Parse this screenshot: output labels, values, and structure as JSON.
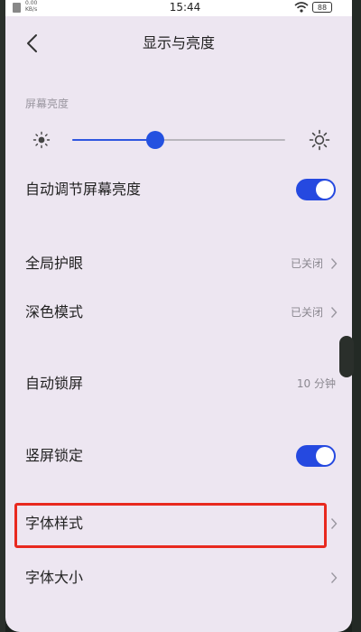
{
  "status_bar": {
    "net_speed": "0.00",
    "net_unit": "KB/s",
    "time": "15:44",
    "battery": "88"
  },
  "header": {
    "title": "显示与亮度"
  },
  "brightness": {
    "section_label": "屏幕亮度",
    "level": 0.39
  },
  "settings": {
    "auto_brightness": {
      "label": "自动调节屏幕亮度",
      "enabled": true
    },
    "eye_protection": {
      "label": "全局护眼",
      "value": "已关闭"
    },
    "dark_mode": {
      "label": "深色模式",
      "value": "已关闭"
    },
    "auto_lock": {
      "label": "自动锁屏",
      "value": "10 分钟"
    },
    "portrait_lock": {
      "label": "竖屏锁定",
      "enabled": true
    },
    "font_style": {
      "label": "字体样式"
    },
    "font_size": {
      "label": "字体大小"
    }
  },
  "colors": {
    "accent": "#2451e0",
    "highlight": "#e8291f",
    "background": "#ede6f1"
  },
  "icons": [
    "back-icon",
    "sun-small-icon",
    "sun-large-icon",
    "chevron-right-icon",
    "wifi-icon",
    "battery-icon"
  ]
}
